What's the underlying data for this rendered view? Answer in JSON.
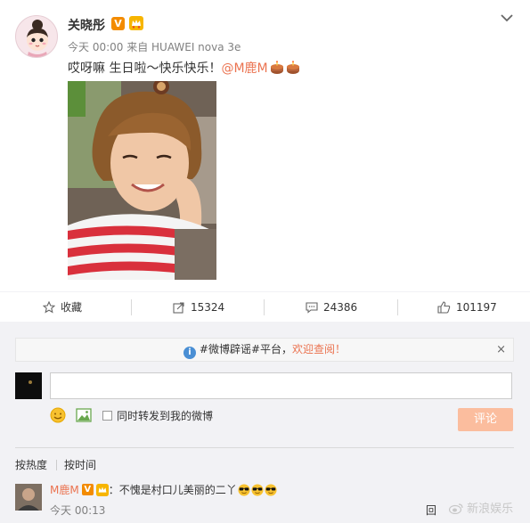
{
  "post": {
    "username": "关晓彤",
    "verified_badge": "V",
    "meta": "今天 00:00 来自 HUAWEI nova 3e",
    "text_before": "哎呀嘛 生日啦～快乐快乐！",
    "mention": "@M鹿M",
    "icons": [
      "avatar-cartoon-girl",
      "crown-badge-icon",
      "chevron-down-icon",
      "birthday-cake-icon",
      "birthday-cake-icon"
    ]
  },
  "actions": {
    "favorite_label": "收藏",
    "forward_count": "15324",
    "comment_count": "24386",
    "like_count": "101197"
  },
  "comment_area": {
    "notice_prefix": "#微博辟谣#平台，",
    "notice_link": "欢迎查阅！",
    "notice_close": "×",
    "forward_checkbox_label": "同时转发到我的微博",
    "submit_label": "评论",
    "sort_hot": "按热度",
    "sort_time": "按时间"
  },
  "comments": [
    {
      "author": "M鹿M",
      "badge": "V",
      "text": "：不愧是村口儿美丽的二丫",
      "time": "今天 00:13",
      "reply_partial": "回",
      "emoji": [
        "sunglasses-emoji-icon",
        "sunglasses-emoji-icon",
        "sunglasses-emoji-icon"
      ]
    }
  ],
  "watermark": "新浪娱乐",
  "colors": {
    "accent_orange": "#eb7350",
    "vip_badge": "#f38b00",
    "submit_disabled": "#fbbd9e",
    "comment_bg": "#f2f2f5",
    "info_blue": "#4a8fd4"
  }
}
